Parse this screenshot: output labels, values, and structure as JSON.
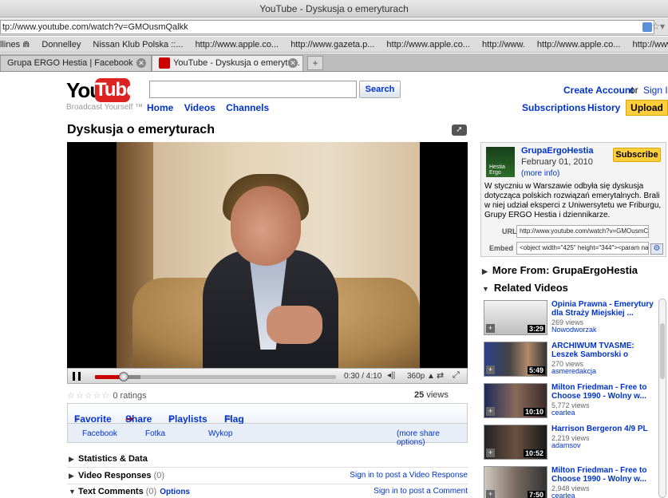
{
  "window": {
    "title": "YouTube - Dyskusja o emeryturach"
  },
  "browser": {
    "url": "tp://www.youtube.com/watch?v=GMOusmQalkk",
    "bookmarks": [
      "llines ⋒",
      "Donnelley",
      "Nissan Klub Polska ::...",
      "http://www.apple.co...",
      "http://www.gazeta.p...",
      "http://www.apple.co...",
      "http://www.",
      "http://www.apple.co...",
      "http://www.apple.co"
    ],
    "tabs": [
      {
        "label": "Grupa ERGO Hestia | Facebook"
      },
      {
        "label": "YouTube - Dyskusja o emerytu..."
      }
    ],
    "new_tab": "+"
  },
  "header": {
    "logo_you": "You",
    "logo_tube": "Tube",
    "tagline": "Broadcast Yourself ™",
    "search_value": "",
    "search_button": "Search",
    "nav": [
      "Home",
      "Videos",
      "Channels"
    ],
    "create_account": "Create Account",
    "or": "or",
    "sign_in": "Sign In",
    "subscriptions": "Subscriptions",
    "history": "History",
    "upload": "Upload"
  },
  "video": {
    "title": "Dyskusja o emeryturach",
    "time": "0:30 / 4:10",
    "quality": "360p ▲",
    "progress_fraction": 0.12,
    "buffered_fraction": 0.19,
    "ratings": "0 ratings",
    "views": "25",
    "views_label": "views"
  },
  "actions": {
    "favorite": "Favorite",
    "share": "Share",
    "playlists": "Playlists",
    "flag": "Flag",
    "share_targets": [
      "Facebook",
      "Fotka",
      "Wykop"
    ],
    "more_share": "(more share options)"
  },
  "sections": {
    "stats": "Statistics & Data",
    "responses": "Video Responses",
    "responses_count": "(0)",
    "responses_link": "Sign in to post a Video Response",
    "comments": "Text Comments",
    "comments_count": "(0)",
    "comments_options": "Options",
    "comments_link": "Sign in to post a Comment"
  },
  "channel": {
    "name": "GrupaErgoHestia",
    "date": "February 01, 2010",
    "more_info": "(more info)",
    "subscribe": "Subscribe",
    "thumb_text": "Hestia Ergo",
    "description": "W styczniu w Warszawie odbyła się dyskusja dotycząca polskich rozwiązań emerytalnych. Brali w niej udział eksperci z Uniwersytetu we Friburgu, Grupy ERGO Hestia i dziennikarze.",
    "url_label": "URL",
    "url_value": "http://www.youtube.com/watch?v=GMOusmC",
    "embed_label": "Embed",
    "embed_value": "<object width=\"425\" height=\"344\"><param na"
  },
  "sidebar": {
    "more_from": "More From: GrupaErgoHestia",
    "related": "Related Videos",
    "items": [
      {
        "title": "Opinia Prawna - Emerytury dla Straży Miejskiej ...",
        "views": "269 views",
        "user": "Nowodworzak",
        "duration": "3:29"
      },
      {
        "title": "ARCHIWUM TVASME: Leszek Samborski o",
        "views": "270 views",
        "user": "asmeredakcja",
        "duration": "5:49"
      },
      {
        "title": "Milton Friedman - Free to Choose 1990 - Wolny w...",
        "views": "5,772 views",
        "user": "cearlea",
        "duration": "10:10"
      },
      {
        "title": "Harrison Bergeron 4/9 PL",
        "views": "2,219 views",
        "user": "adamsov",
        "duration": "10:52"
      },
      {
        "title": "Milton Friedman - Free to Choose 1990 - Wolny w...",
        "views": "2,948 views",
        "user": "cearlea",
        "duration": "7:50"
      }
    ]
  },
  "colors": {
    "link": "#0033cc",
    "brand_red": "#dd2222",
    "button_yellow": "#ffce3c",
    "progress_red": "#cc0000"
  }
}
